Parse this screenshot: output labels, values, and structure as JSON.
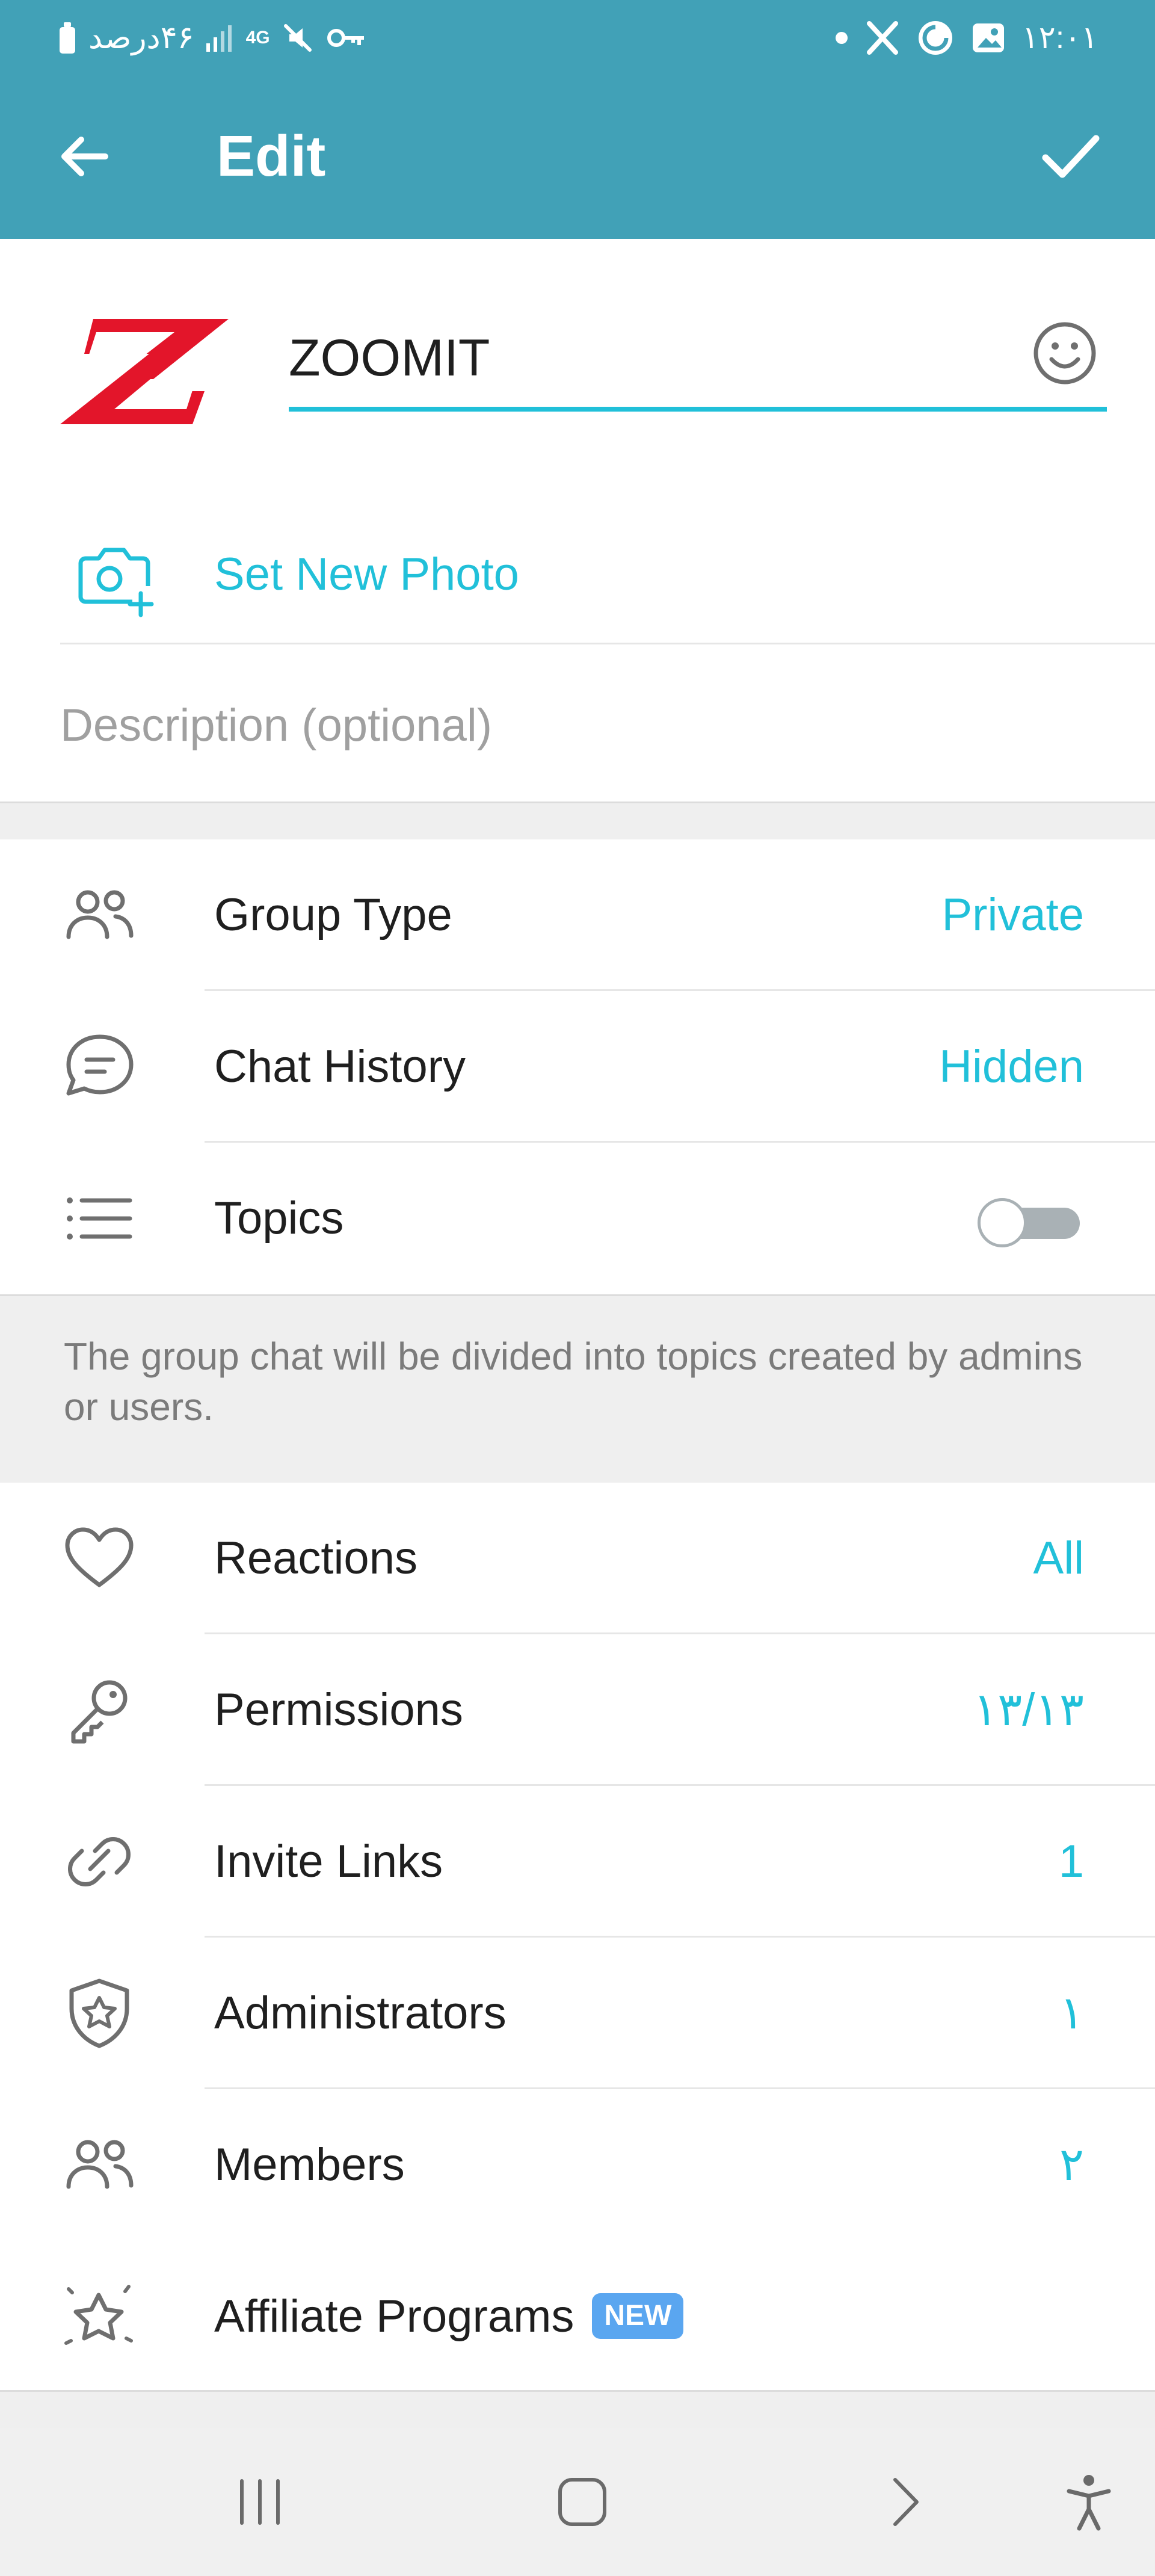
{
  "status_bar": {
    "battery_text": "۴۶درصد",
    "network": "4G",
    "time": "۱۲:۰۱"
  },
  "app_bar": {
    "title": "Edit"
  },
  "group": {
    "name": "ZOOMIT",
    "set_photo_label": "Set New Photo",
    "description_placeholder": "Description (optional)",
    "description_value": ""
  },
  "settings": {
    "group_type": {
      "label": "Group Type",
      "value": "Private"
    },
    "chat_history": {
      "label": "Chat History",
      "value": "Hidden"
    },
    "topics": {
      "label": "Topics",
      "enabled": false
    }
  },
  "topics_info": "The group chat will be divided into topics created by admins or users.",
  "management": {
    "reactions": {
      "label": "Reactions",
      "value": "All"
    },
    "permissions": {
      "label": "Permissions",
      "value": "۱۳/۱۳"
    },
    "invite_links": {
      "label": "Invite Links",
      "value": "1"
    },
    "administrators": {
      "label": "Administrators",
      "value": "۱"
    },
    "members": {
      "label": "Members",
      "value": "۲"
    },
    "affiliate_programs": {
      "label": "Affiliate Programs",
      "badge": "NEW"
    }
  },
  "colors": {
    "header": "#41a1b7",
    "accent": "#21c0d9",
    "logo_red": "#e3152a",
    "badge": "#5aa6f0",
    "icon_gray": "#6f6f6f"
  }
}
